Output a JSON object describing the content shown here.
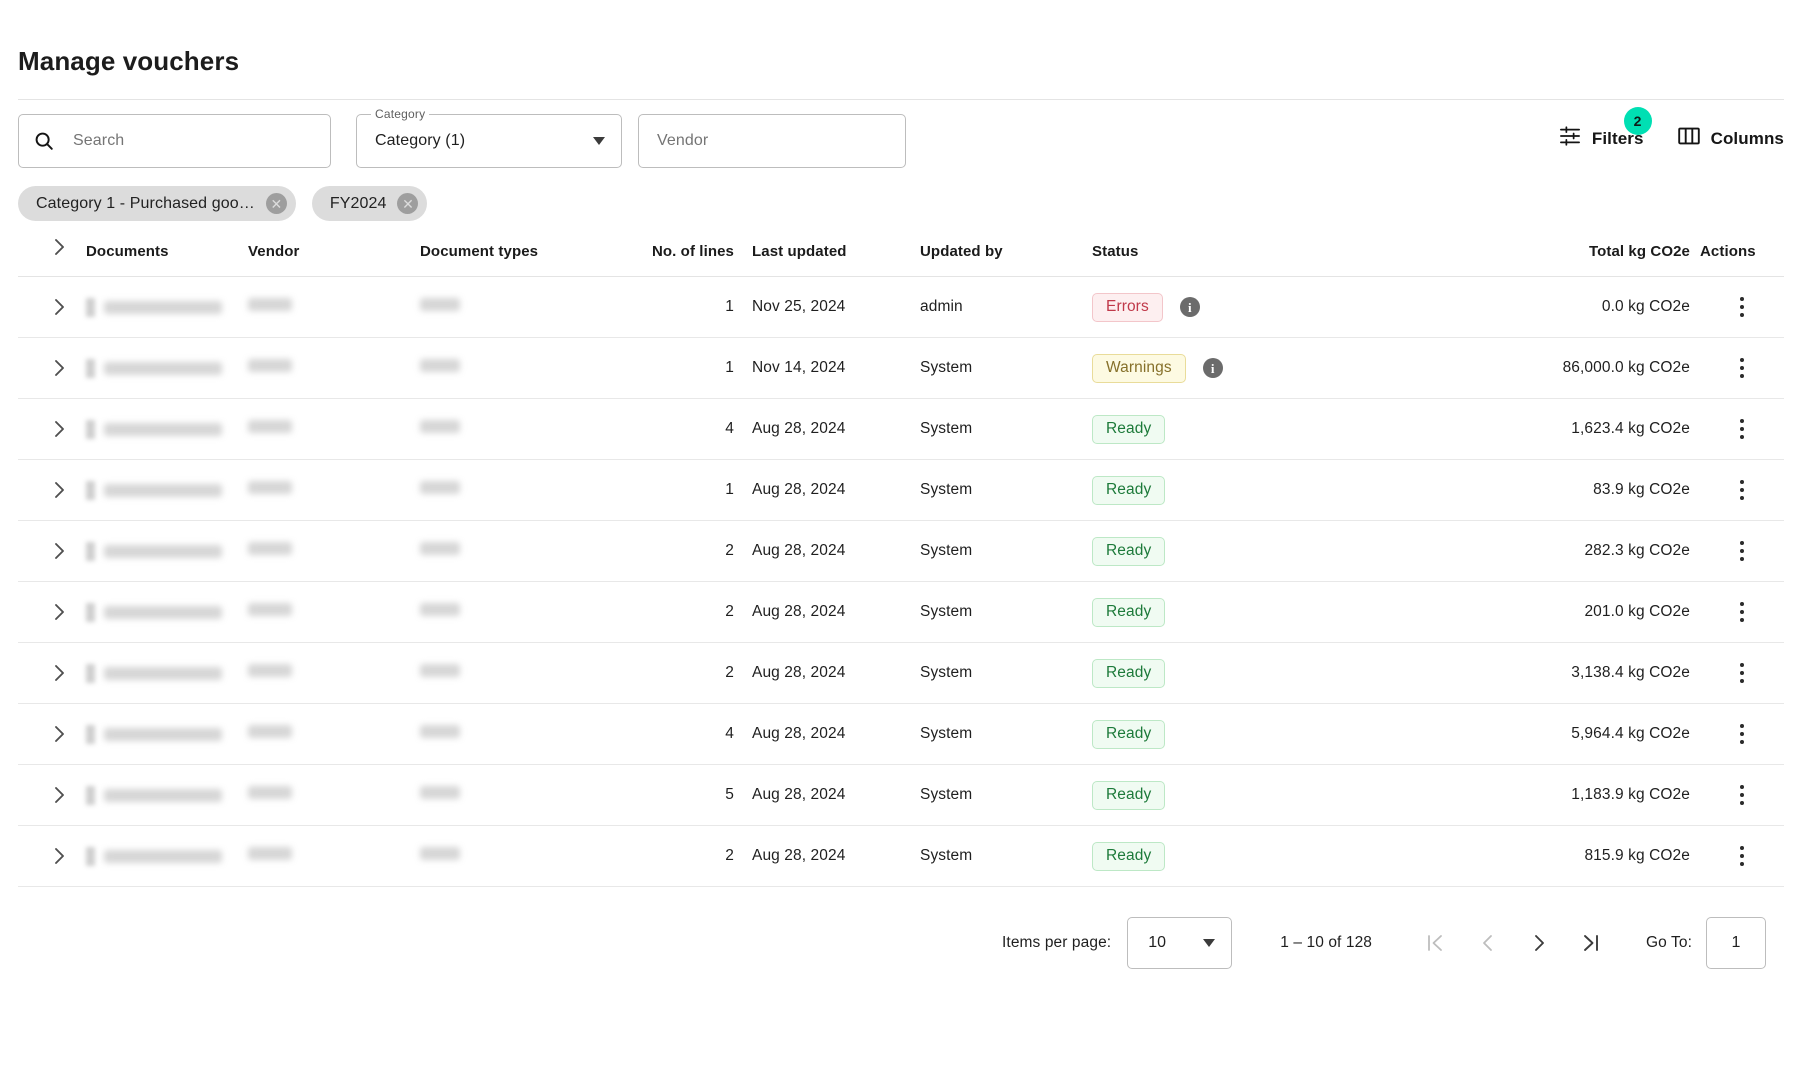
{
  "header": {
    "title": "Manage vouchers"
  },
  "toolbar": {
    "search": {
      "placeholder": "Search",
      "value": "",
      "icon": "search-icon"
    },
    "category": {
      "legend": "Category",
      "value": "Category (1)",
      "icon": "chevron-down-icon"
    },
    "vendor": {
      "placeholder": "Vendor",
      "value": ""
    },
    "filters": {
      "label": "Filters",
      "badge": "2",
      "icon": "filter-sliders-icon",
      "badge_color": "#00dfb3"
    },
    "columns": {
      "label": "Columns",
      "icon": "columns-icon"
    }
  },
  "chips": [
    {
      "label": "Category 1 - Purchased goo…",
      "remove_icon": "close-circle-icon"
    },
    {
      "label": "FY2024",
      "remove_icon": "close-circle-icon"
    }
  ],
  "table": {
    "columns": [
      "Documents",
      "Vendor",
      "Document types",
      "No. of lines",
      "Last updated",
      "Updated by",
      "Status",
      "Total kg CO2e",
      "Actions"
    ],
    "rows": [
      {
        "lines": "1",
        "last_updated": "Nov 25, 2024",
        "updated_by": "admin",
        "status": "Errors",
        "status_kind": "error",
        "has_info": true,
        "co2e": "0.0 kg CO2e"
      },
      {
        "lines": "1",
        "last_updated": "Nov 14, 2024",
        "updated_by": "System",
        "status": "Warnings",
        "status_kind": "warn",
        "has_info": true,
        "co2e": "86,000.0 kg CO2e"
      },
      {
        "lines": "4",
        "last_updated": "Aug 28, 2024",
        "updated_by": "System",
        "status": "Ready",
        "status_kind": "ready",
        "has_info": false,
        "co2e": "1,623.4 kg CO2e"
      },
      {
        "lines": "1",
        "last_updated": "Aug 28, 2024",
        "updated_by": "System",
        "status": "Ready",
        "status_kind": "ready",
        "has_info": false,
        "co2e": "83.9 kg CO2e"
      },
      {
        "lines": "2",
        "last_updated": "Aug 28, 2024",
        "updated_by": "System",
        "status": "Ready",
        "status_kind": "ready",
        "has_info": false,
        "co2e": "282.3 kg CO2e"
      },
      {
        "lines": "2",
        "last_updated": "Aug 28, 2024",
        "updated_by": "System",
        "status": "Ready",
        "status_kind": "ready",
        "has_info": false,
        "co2e": "201.0 kg CO2e"
      },
      {
        "lines": "2",
        "last_updated": "Aug 28, 2024",
        "updated_by": "System",
        "status": "Ready",
        "status_kind": "ready",
        "has_info": false,
        "co2e": "3,138.4 kg CO2e"
      },
      {
        "lines": "4",
        "last_updated": "Aug 28, 2024",
        "updated_by": "System",
        "status": "Ready",
        "status_kind": "ready",
        "has_info": false,
        "co2e": "5,964.4 kg CO2e"
      },
      {
        "lines": "5",
        "last_updated": "Aug 28, 2024",
        "updated_by": "System",
        "status": "Ready",
        "status_kind": "ready",
        "has_info": false,
        "co2e": "1,183.9 kg CO2e"
      },
      {
        "lines": "2",
        "last_updated": "Aug 28, 2024",
        "updated_by": "System",
        "status": "Ready",
        "status_kind": "ready",
        "has_info": false,
        "co2e": "815.9 kg CO2e"
      }
    ],
    "redacted_note": "Documents, Vendor and Document types cell contents are blurred/redacted in the screenshot"
  },
  "pagination": {
    "items_per_page_label": "Items per page:",
    "items_per_page_value": "10",
    "range": "1 – 10 of 128",
    "first_icon": "first-page-icon",
    "prev_icon": "previous-page-icon",
    "next_icon": "next-page-icon",
    "last_icon": "last-page-icon",
    "goto_label": "Go To:",
    "goto_value": "1"
  }
}
